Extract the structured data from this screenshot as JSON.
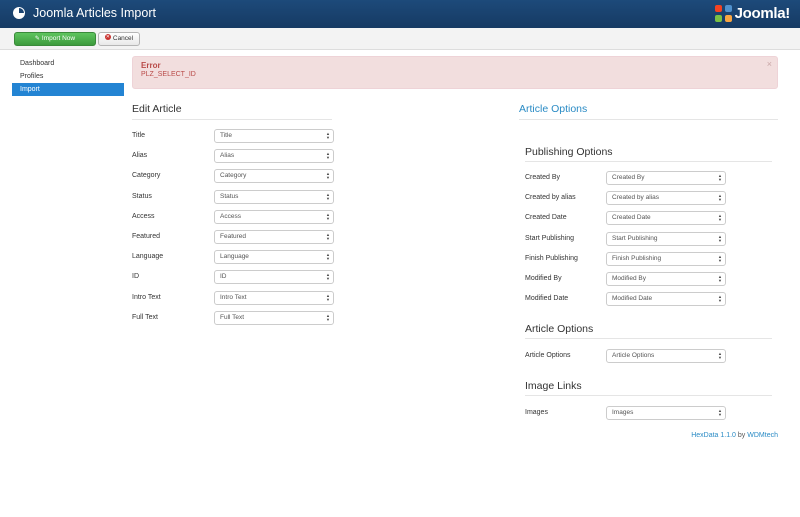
{
  "app": {
    "title": "Joomla Articles Import",
    "logo_text": "Joomla!"
  },
  "toolbar": {
    "import_label": "Import Now",
    "cancel_label": "Cancel"
  },
  "sidebar": {
    "items": [
      {
        "label": "Dashboard",
        "active": false
      },
      {
        "label": "Profiles",
        "active": false
      },
      {
        "label": "Import",
        "active": true
      }
    ]
  },
  "alert": {
    "heading": "Error",
    "message": "PLZ_SELECT_ID",
    "close": "×"
  },
  "edit_article": {
    "heading": "Edit Article",
    "fields": [
      {
        "label": "Title",
        "value": "Title"
      },
      {
        "label": "Alias",
        "value": "Alias"
      },
      {
        "label": "Category",
        "value": "Category"
      },
      {
        "label": "Status",
        "value": "Status"
      },
      {
        "label": "Access",
        "value": "Access"
      },
      {
        "label": "Featured",
        "value": "Featured"
      },
      {
        "label": "Language",
        "value": "Language"
      },
      {
        "label": "ID",
        "value": "ID"
      },
      {
        "label": "Intro Text",
        "value": "Intro Text"
      },
      {
        "label": "Full Text",
        "value": "Full Text"
      }
    ]
  },
  "article_options_panel": {
    "heading": "Article Options",
    "publishing": {
      "heading": "Publishing Options",
      "fields": [
        {
          "label": "Created By",
          "value": "Created By"
        },
        {
          "label": "Created by alias",
          "value": "Created by alias"
        },
        {
          "label": "Created Date",
          "value": "Created Date"
        },
        {
          "label": "Start Publishing",
          "value": "Start Publishing"
        },
        {
          "label": "Finish Publishing",
          "value": "Finish Publishing"
        },
        {
          "label": "Modified By",
          "value": "Modified By"
        },
        {
          "label": "Modified Date",
          "value": "Modified Date"
        }
      ]
    },
    "options": {
      "heading": "Article Options",
      "fields": [
        {
          "label": "Article Options",
          "value": "Article Options"
        }
      ]
    },
    "images": {
      "heading": "Image Links",
      "fields": [
        {
          "label": "Images",
          "value": "Images"
        }
      ]
    }
  },
  "credit": {
    "product": "HexData 1.1.0",
    "by": "by",
    "vendor": "WDMtech"
  },
  "colors": {
    "header": "#1b4472",
    "primary": "#2384d3",
    "success": "#46a546",
    "error_bg": "#f2dede",
    "error_text": "#b94a48",
    "link": "#2a8bc5"
  }
}
